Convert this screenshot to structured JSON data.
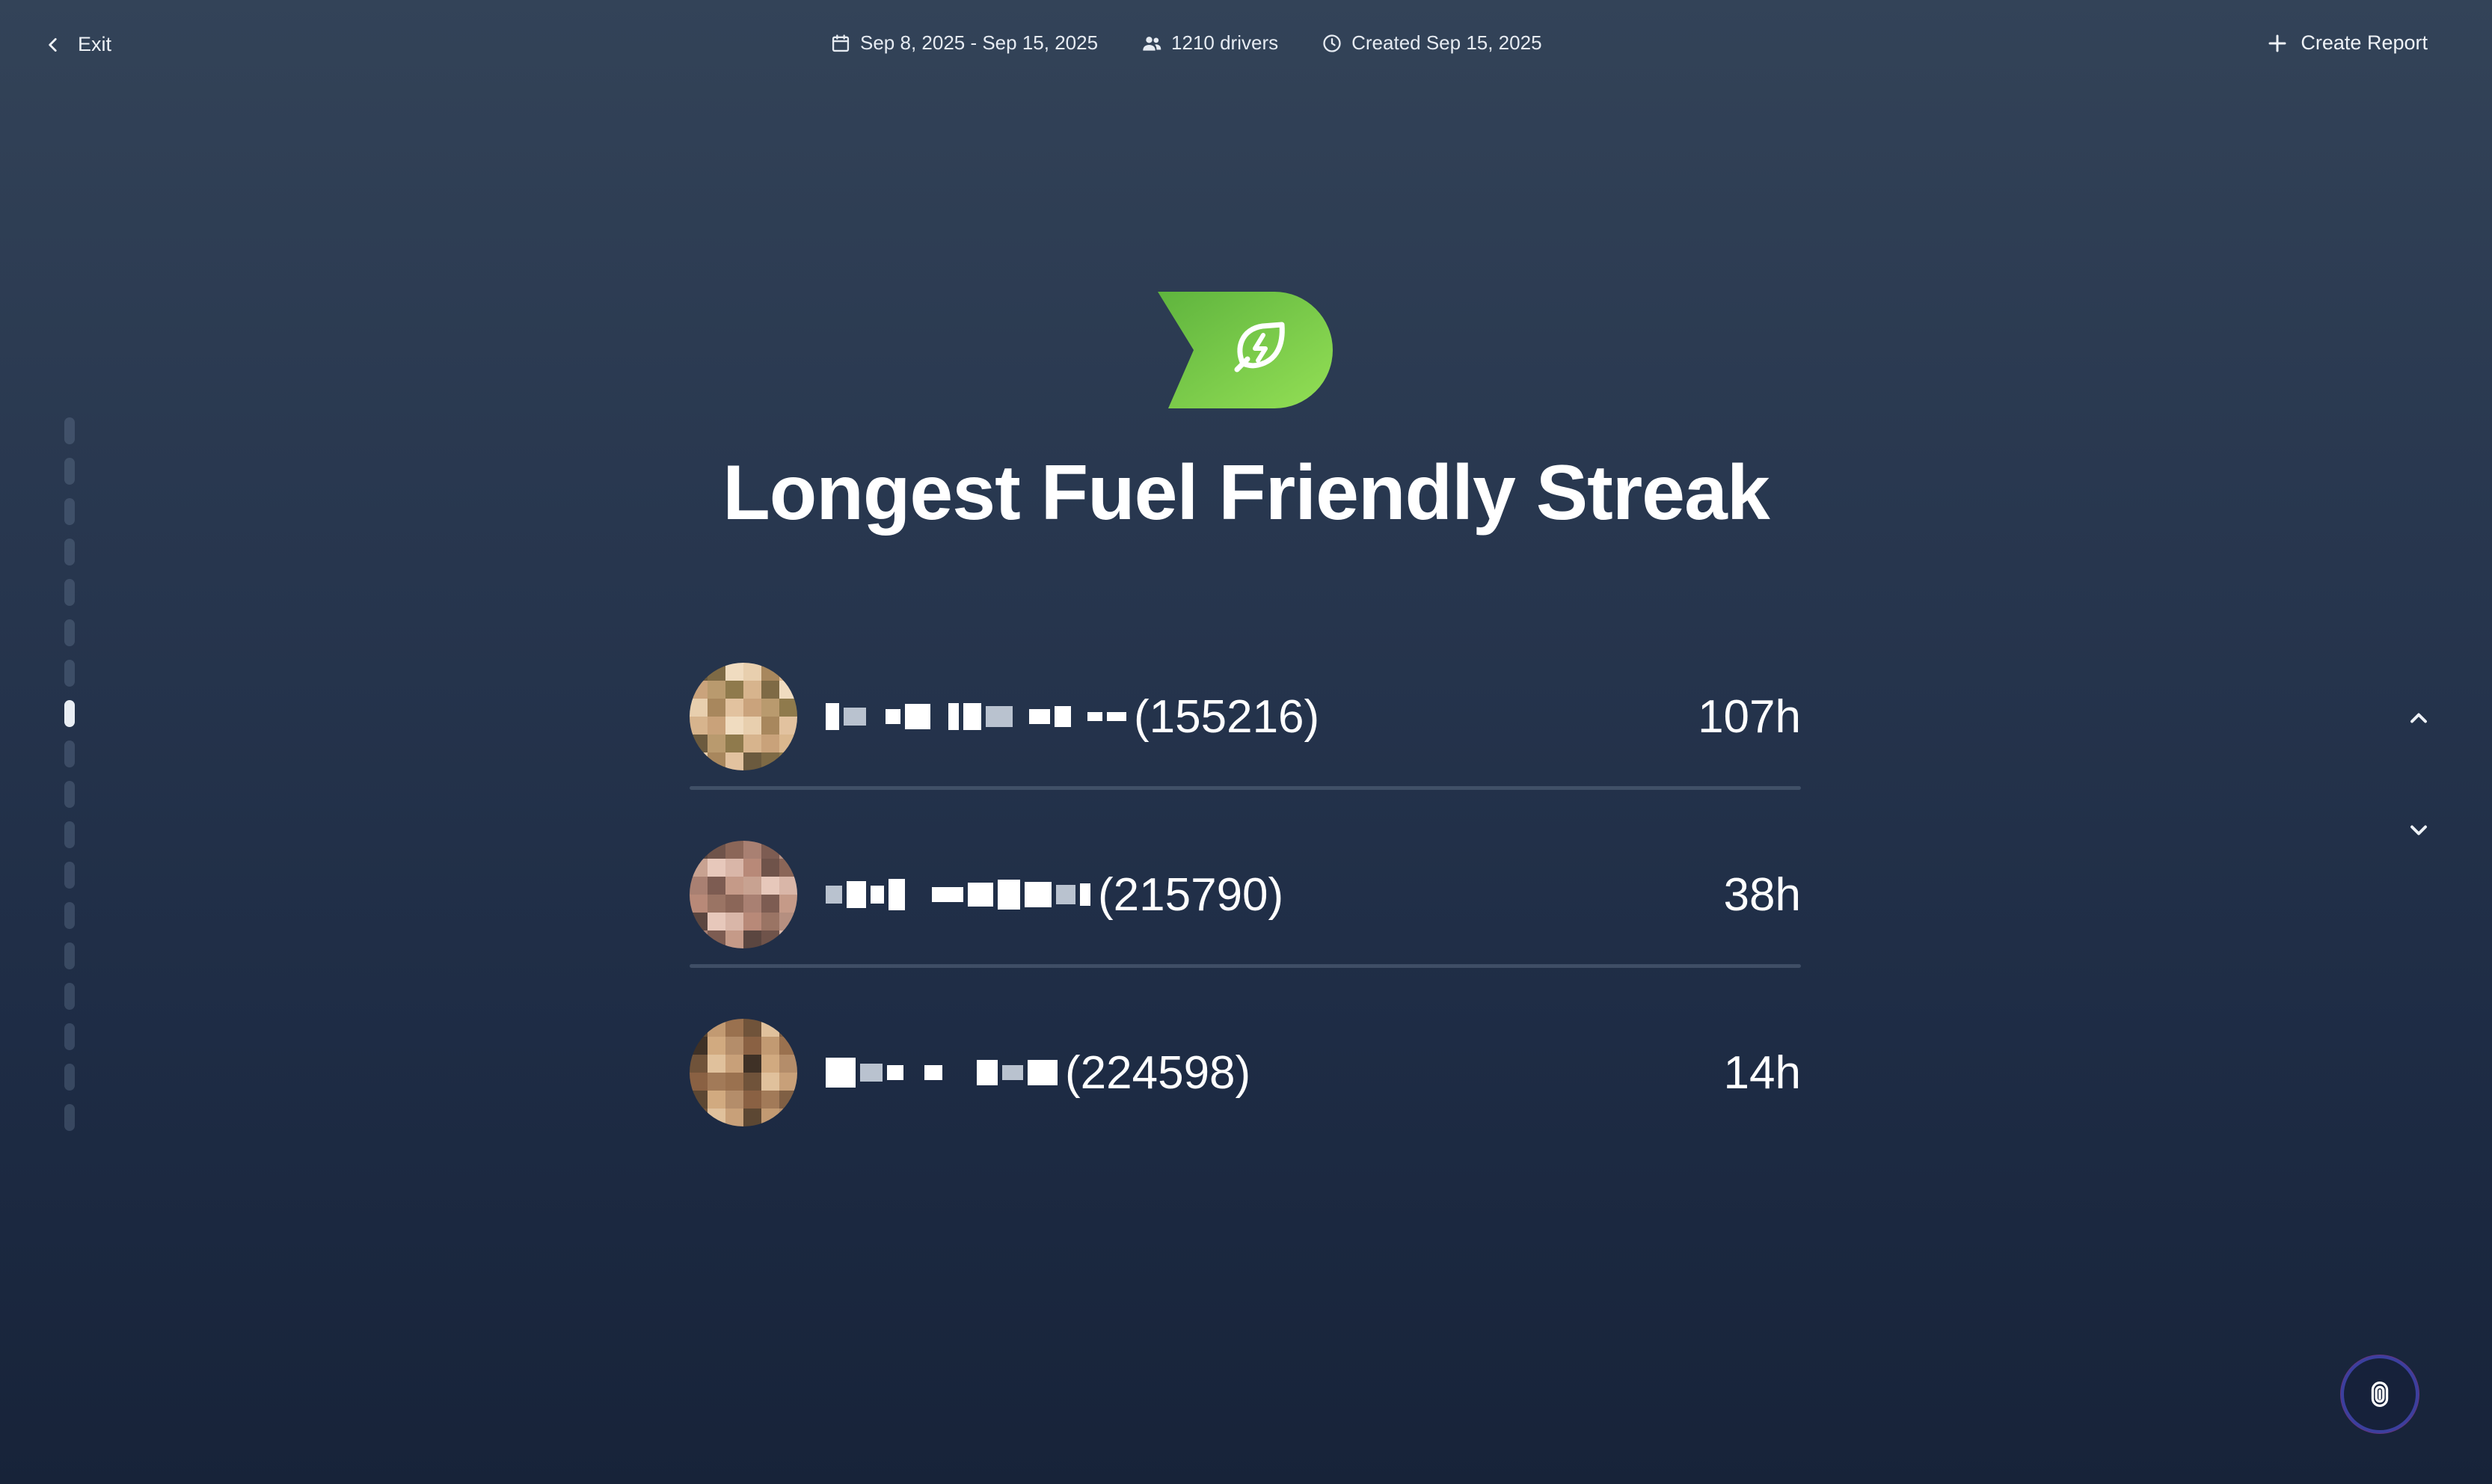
{
  "topbar": {
    "exit_label": "Exit",
    "date_range": "Sep 8, 2025 - Sep 15, 2025",
    "drivers": "1210 drivers",
    "created": "Created Sep 15, 2025",
    "create_label": "Create Report"
  },
  "slide": {
    "title": "Longest Fuel Friendly Streak",
    "badge_icon": "leaf-lightning-icon",
    "accent_color": "#7dd24a",
    "progress": {
      "total": 18,
      "current": 8
    }
  },
  "leaders": [
    {
      "rank": 1,
      "driver_id": "(155216)",
      "value": "107h"
    },
    {
      "rank": 2,
      "driver_id": "(215790)",
      "value": "38h"
    },
    {
      "rank": 3,
      "driver_id": "(224598)",
      "value": "14h"
    }
  ],
  "icons": {
    "exit": "chevron-left-icon",
    "date": "calendar-icon",
    "drivers": "users-icon",
    "created": "clock-icon",
    "create": "plus-icon",
    "prev": "chevron-up-icon",
    "next": "chevron-down-icon",
    "fab": "fingerprint-icon"
  }
}
